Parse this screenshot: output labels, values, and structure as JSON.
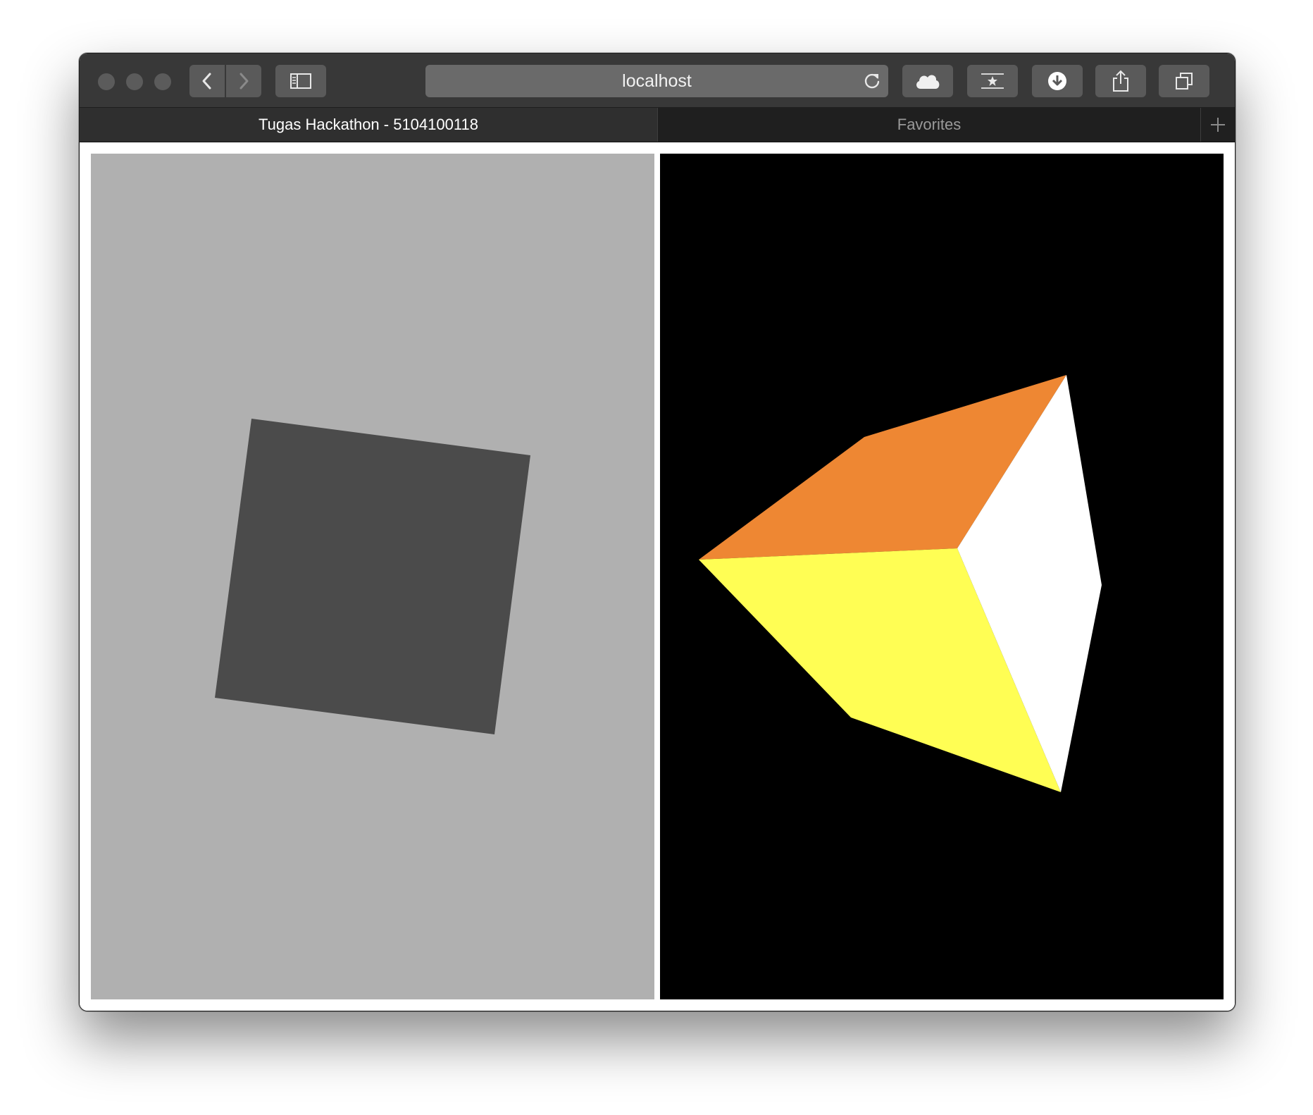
{
  "browser": {
    "address_url": "localhost",
    "tabs": [
      {
        "label": "Tugas Hackathon - 5104100118",
        "active": true
      },
      {
        "label": "Favorites",
        "active": false
      }
    ],
    "toolbar_icons": [
      "sidebar-icon",
      "cloud-icon",
      "reading-list-icon",
      "download-icon",
      "share-icon",
      "tabs-overview-icon"
    ]
  },
  "scene": {
    "left_canvas": {
      "background": "#b0b0b0",
      "square_color": "#4b4b4b"
    },
    "right_canvas": {
      "background": "#000000",
      "face_top_color": "#ee8733",
      "face_front_color": "#fffe54",
      "face_side_color": "#ffffff"
    }
  }
}
